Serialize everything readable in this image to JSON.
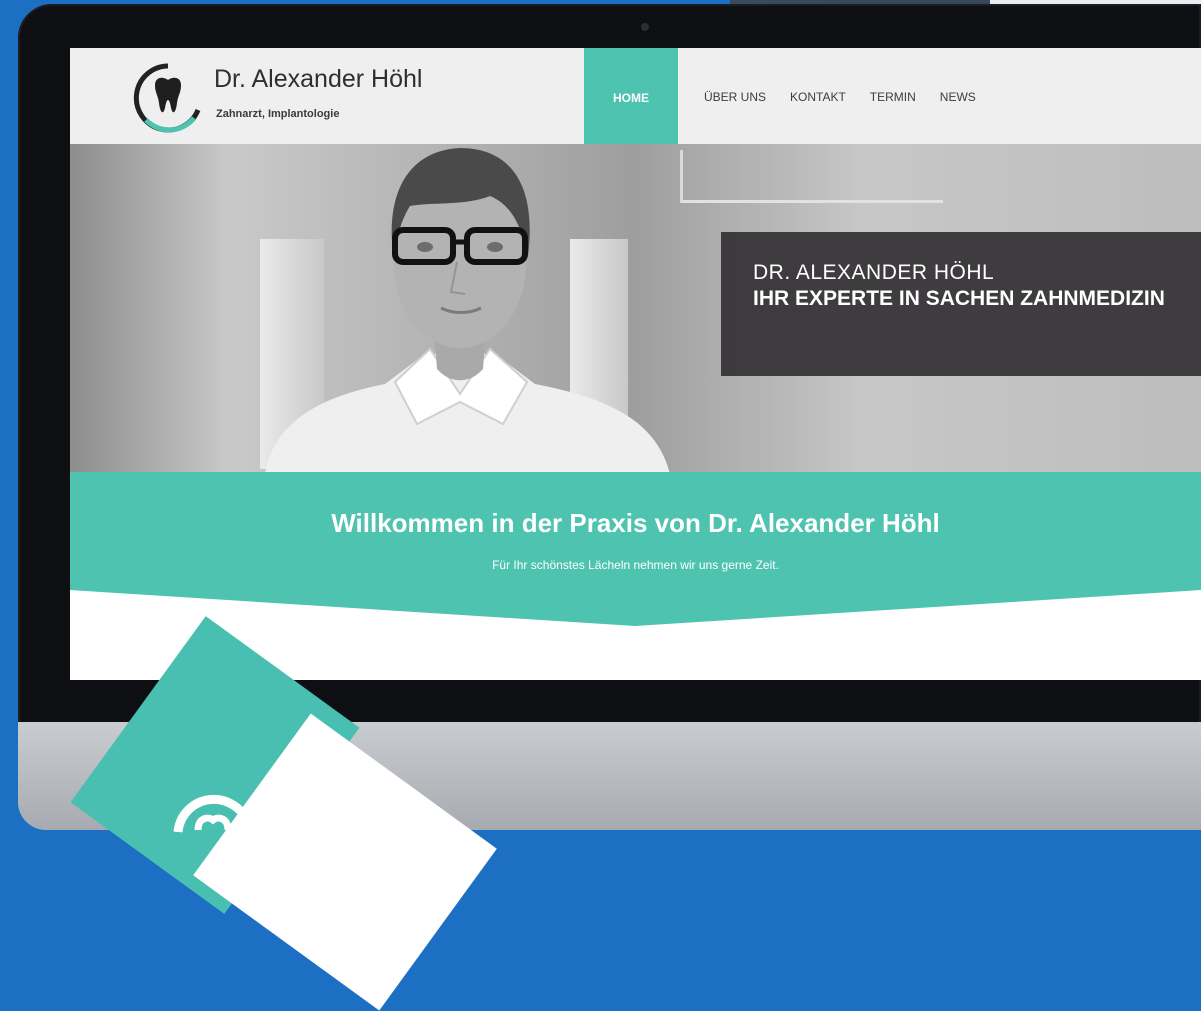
{
  "brand": {
    "name": "Dr. Alexander Höhl",
    "tagline": "Zahnarzt, Implantologie",
    "logo_icon": "tooth-icon",
    "accent_color": "#4dc3b0"
  },
  "nav": {
    "items": [
      {
        "label": "HOME",
        "active": true
      },
      {
        "label": "ÜBER UNS",
        "active": false
      },
      {
        "label": "KONTAKT",
        "active": false
      },
      {
        "label": "TERMIN",
        "active": false
      },
      {
        "label": "NEWS",
        "active": false
      }
    ]
  },
  "hero": {
    "line1": "DR. ALEXANDER HÖHL",
    "line2": "IHR EXPERTE IN SACHEN ZAHNMEDIZIN"
  },
  "welcome": {
    "title": "Willkommen in der Praxis von Dr. Alexander Höhl",
    "subtitle": "Für Ihr schönstes Lächeln nehmen wir uns gerne Zeit."
  }
}
